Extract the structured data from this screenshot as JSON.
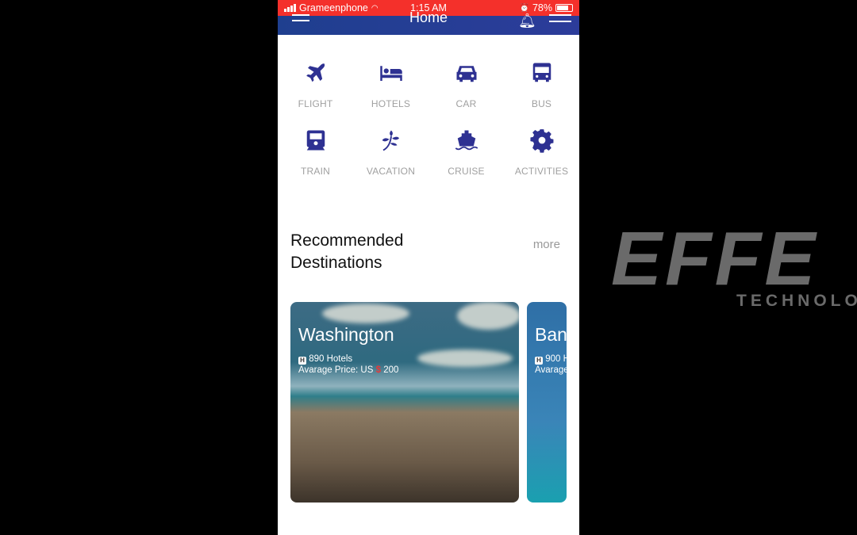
{
  "status_bar": {
    "carrier": "Grameenphone",
    "time": "1:15 AM",
    "battery": "78%",
    "battery_level": 0.78
  },
  "header": {
    "title": "Home"
  },
  "categories": [
    {
      "label": "FLIGHT",
      "icon": "airplane-icon"
    },
    {
      "label": "HOTELS",
      "icon": "bed-icon"
    },
    {
      "label": "CAR",
      "icon": "car-icon"
    },
    {
      "label": "BUS",
      "icon": "bus-icon"
    },
    {
      "label": "TRAIN",
      "icon": "train-icon"
    },
    {
      "label": "VACATION",
      "icon": "leaf-icon"
    },
    {
      "label": "CRUISE",
      "icon": "ship-icon"
    },
    {
      "label": "ACTIVITIES",
      "icon": "gear-icon"
    }
  ],
  "section": {
    "title": "Recommended Destinations",
    "more": "more"
  },
  "destinations": [
    {
      "name": "Washington",
      "hotels": "890 Hotels",
      "price_prefix": "Avarage Price: US",
      "currency": "$",
      "price": "200"
    },
    {
      "name": "Ban",
      "hotels": "900 H",
      "price_prefix": "Avarage"
    }
  ],
  "watermark": {
    "text": "EFFE",
    "sub": "TECHNOLO"
  },
  "colors": {
    "accent": "#2e3192",
    "status_bar": "#f4302b",
    "header": "#243d94"
  }
}
